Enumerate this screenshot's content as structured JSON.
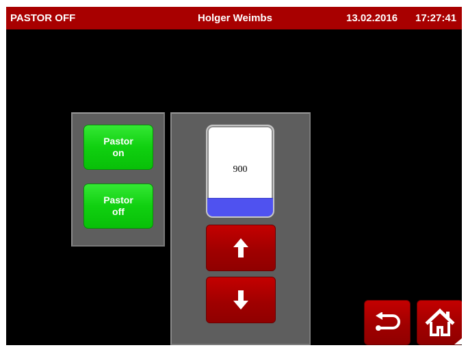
{
  "header": {
    "status": "PASTOR OFF",
    "user": "Holger Weimbs",
    "date": "13.02.2016",
    "time": "17:27:41"
  },
  "pastor_panel": {
    "on_label": "Pastor\non",
    "off_label": "Pastor\noff"
  },
  "setpoint": {
    "value": "900",
    "fill_fraction": 0.2
  },
  "icons": {
    "up": "arrow-up-icon",
    "down": "arrow-down-icon",
    "back": "back-arrow-icon",
    "home": "home-icon"
  },
  "colors": {
    "header_bg": "#a80000",
    "green_button": "#10d010",
    "red_button": "#a00000",
    "gauge_fill": "#4f52f0",
    "panel_bg": "#5e5e5e"
  }
}
